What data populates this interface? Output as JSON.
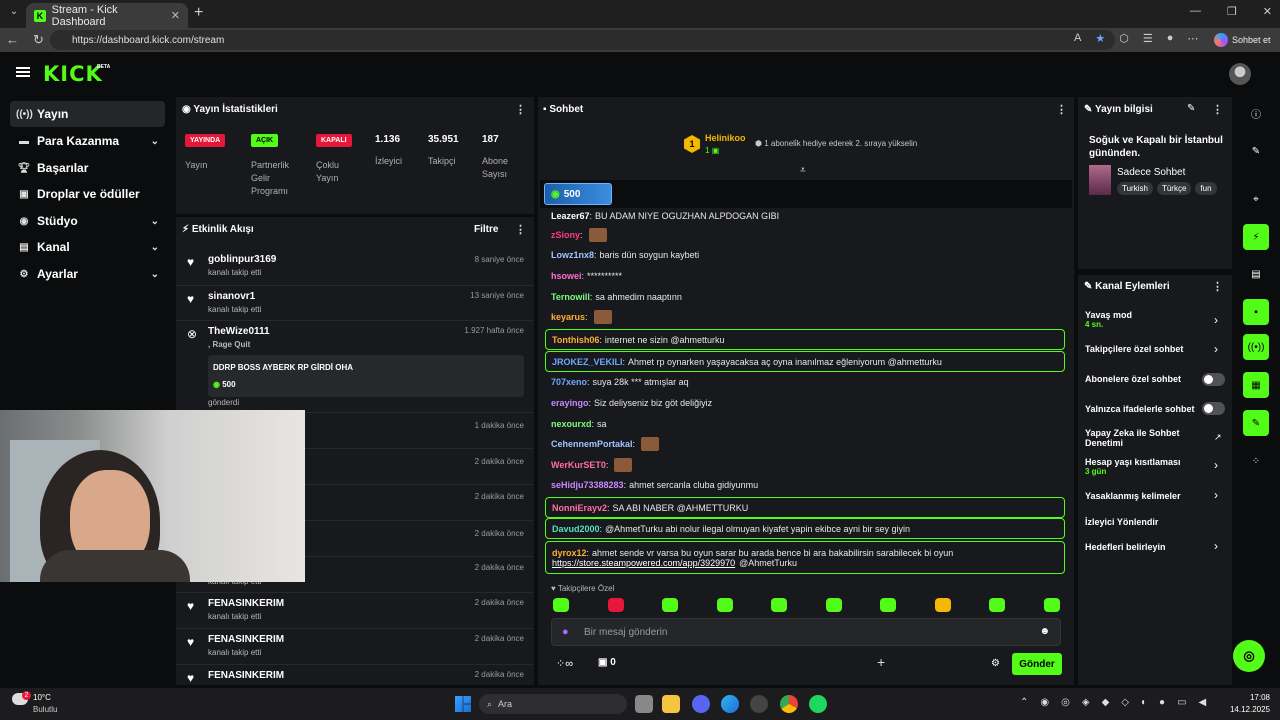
{
  "browser": {
    "tab_title": "Stream - Kick Dashboard",
    "url": "https://dashboard.kick.com/stream",
    "copilot_label": "Sohbet et"
  },
  "header": {
    "logo": "KICK",
    "beta": "BETA"
  },
  "sidebar": {
    "items": [
      {
        "label": "Yayın"
      },
      {
        "label": "Para Kazanma"
      },
      {
        "label": "Başarılar"
      },
      {
        "label": "Droplar ve ödüller"
      },
      {
        "label": "Stüdyo"
      },
      {
        "label": "Kanal"
      },
      {
        "label": "Ayarlar"
      }
    ]
  },
  "stats": {
    "title": "Yayın İstatistikleri",
    "badges": [
      {
        "badge": "YAYINDA",
        "label": "Yayın"
      },
      {
        "badge": "AÇIK",
        "label": "Partnerlik Gelir Programı"
      },
      {
        "badge": "KAPALI",
        "label": "Çoklu Yayın"
      }
    ],
    "numbers": [
      {
        "value": "1.136",
        "label": "İzleyici"
      },
      {
        "value": "35.951",
        "label": "Takipçi"
      },
      {
        "value": "187",
        "label": "Abone Sayısı"
      }
    ]
  },
  "activity": {
    "title": "Etkinlik Akışı",
    "filter": "Filtre",
    "items": [
      {
        "name": "goblinpur3169",
        "sub": "kanalı takip etti",
        "time": "8 saniye önce"
      },
      {
        "name": "sinanovr1",
        "sub": "kanalı takip etti",
        "time": "13 saniye önce"
      },
      {
        "name": "TheWize0111",
        "sub": ", Rage Quit",
        "time": "1.927 hafta önce",
        "card": "DDRP BOSS AYBERK RP GİRDİ OHA",
        "amount": "500",
        "sent": "gönderdi"
      },
      {
        "time": "1 dakika önce"
      },
      {
        "time": "2 dakika önce"
      },
      {
        "time": "2 dakika önce"
      },
      {
        "time": "2 dakika önce"
      },
      {
        "sub": "kanalı takip etti",
        "time": "2 dakika önce"
      },
      {
        "name": "FENASINKERIM",
        "sub": "kanalı takip etti",
        "time": "2 dakika önce"
      },
      {
        "name": "FENASINKERIM",
        "sub": "kanalı takip etti",
        "time": "2 dakika önce"
      },
      {
        "name": "FENASINKERIM",
        "time": "2 dakika önce"
      }
    ]
  },
  "chat": {
    "title": "Sohbet",
    "top_gifter": {
      "rank": "1",
      "name": "Helinikoo",
      "count": "1"
    },
    "gift_hint": "1 aboneli̇k hediye ederek 2. sıraya yükselin",
    "pinned_amount": "500",
    "messages": [
      {
        "user": "Leazer67",
        "text": "BU ADAM NIYE OGUZHAN ALPDOGAN GIBI",
        "color": "#ffffff"
      },
      {
        "user": "zSiony",
        "text": "",
        "color": "#ff3d7a",
        "emote": true
      },
      {
        "user": "Lowz1nx8",
        "text": "baris dün soygun kaybeti",
        "color": "#9fc4ff"
      },
      {
        "user": "hsowei",
        "text": "**********",
        "color": "#ff6fd0"
      },
      {
        "user": "Ternowill",
        "text": "sa ahmedim naaptınn",
        "color": "#7cfc7c"
      },
      {
        "user": "keyarus",
        "text": "",
        "color": "#ffae3b",
        "emote": true
      },
      {
        "user": "Tonthish06",
        "text": "internet ne sizin @ahmetturku",
        "color": "#ffae3b",
        "hl": true
      },
      {
        "user": "JROKEZ_VEKILI",
        "text": "Ahmet rp oynarken yaşayacaksa aç oyna inanılmaz eğleniyorum @ahmetturku",
        "color": "#6fa8ff",
        "hl": true
      },
      {
        "user": "707xeno",
        "text": "suya 28k *** atmışlar aq",
        "color": "#6fa8ff"
      },
      {
        "user": "erayingo",
        "text": "Siz deliyseniz biz göt deliğiyiz",
        "color": "#c58bff"
      },
      {
        "user": "nexourxd",
        "text": "sa",
        "color": "#7cfc7c"
      },
      {
        "user": "CehennemPortakal",
        "text": "",
        "color": "#9fc4ff",
        "emote": true
      },
      {
        "user": "WerKurSET0",
        "text": "",
        "color": "#ff6fa0",
        "emote": true
      },
      {
        "user": "seHidju73388283",
        "text": "ahmet sercanla cluba gidiyunmu",
        "color": "#c58bff"
      },
      {
        "user": "NonniErayv2",
        "text": "SA ABI NABER @AHMETTURKU",
        "color": "#ff6fa0",
        "hl": true
      },
      {
        "user": "Davud2000",
        "text": "@AhmetTurku abi nolur ilegal olmuyan kiyafet yapin ekibce ayni bir sey giyin",
        "color": "#53e0c0",
        "hl": true
      },
      {
        "user": "dyrox12",
        "text": "ahmet sende vr varsa bu oyun sarar bu arada bence bi ara bakabilirsin sarabilecek bi oyun",
        "link": "https://store.steampowered.com/app/3929970",
        "tail": "@AhmetTurku",
        "color": "#ffae3b",
        "hl": true
      }
    ],
    "followers_only": "Takipçilere Özel",
    "input_placeholder": "Bir mesaj gönderin",
    "gift_count": "0",
    "send": "Gönder"
  },
  "stream_info": {
    "title": "Yayın bilgisi",
    "stream_title": "Soğuk ve Kapalı bir İstanbul gününden.",
    "category": "Sadece Sohbet",
    "tags": [
      "Turkish",
      "Türkçe",
      "fun"
    ]
  },
  "channel_actions": {
    "title": "Kanal Eylemleri",
    "items": [
      {
        "label": "Yavaş mod",
        "value": "4 sn."
      },
      {
        "label": "Takipçilere özel sohbet"
      },
      {
        "label": "Abonelere özel sohbet"
      },
      {
        "label": "Yalnızca ifadelerle sohbet"
      },
      {
        "label": "Yapay Zeka ile Sohbet Denetimi"
      },
      {
        "label": "Hesap yaşı kısıtlaması",
        "value": "3 gün"
      },
      {
        "label": "Yasaklanmış kelimeler"
      },
      {
        "label": "İzleyici Yönlendir"
      },
      {
        "label": "Hedefleri belirleyin"
      }
    ]
  },
  "taskbar": {
    "temp": "10°C",
    "weather": "Bulutlu",
    "search": "Ara",
    "time": "17:08",
    "date": "14.12.2025",
    "badge": "2"
  }
}
